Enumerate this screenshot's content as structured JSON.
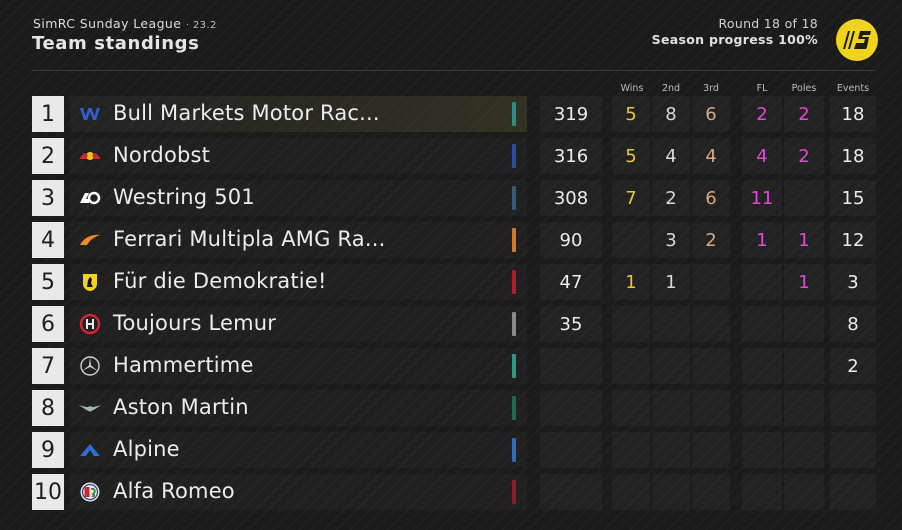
{
  "header": {
    "league": "SimRC Sunday League",
    "edition": "· 23.2",
    "title": "Team standings",
    "round": "Round 18 of 18",
    "progress": "Season progress 100%"
  },
  "columns": {
    "wins": "Wins",
    "second": "2nd",
    "third": "3rd",
    "fl": "FL",
    "poles": "Poles",
    "events": "Events"
  },
  "colors": {
    "wins": "#e8c53a",
    "second": "#d8d8d8",
    "third": "#d9a982",
    "fl": "#e04ad6",
    "poles": "#e04ad6",
    "brand": "#f2d31c"
  },
  "teams": [
    {
      "pos": "1",
      "name": "Bull Markets Motor Rac...",
      "icon": "williams-w-icon",
      "bar": "#2c8f86",
      "points": "319",
      "wins": "5",
      "second": "8",
      "third": "6",
      "fl": "2",
      "poles": "2",
      "events": "18"
    },
    {
      "pos": "2",
      "name": "Nordobst",
      "icon": "redbull-icon",
      "bar": "#2b4fa0",
      "points": "316",
      "wins": "5",
      "second": "4",
      "third": "4",
      "fl": "4",
      "poles": "2",
      "events": "18"
    },
    {
      "pos": "3",
      "name": "Westring 501",
      "icon": "alphatauri-icon",
      "bar": "#365a78",
      "points": "308",
      "wins": "7",
      "second": "2",
      "third": "6",
      "fl": "11",
      "poles": "",
      "events": "15"
    },
    {
      "pos": "4",
      "name": "Ferrari Multipla AMG Ra...",
      "icon": "mclaren-icon",
      "bar": "#d6782a",
      "points": "90",
      "wins": "",
      "second": "3",
      "third": "2",
      "fl": "1",
      "poles": "1",
      "events": "12"
    },
    {
      "pos": "5",
      "name": "Für die Demokratie!",
      "icon": "ferrari-icon",
      "bar": "#b01c2a",
      "points": "47",
      "wins": "1",
      "second": "1",
      "third": "",
      "fl": "",
      "poles": "1",
      "events": "3"
    },
    {
      "pos": "6",
      "name": "Toujours Lemur",
      "icon": "haas-icon",
      "bar": "#8a8a8a",
      "points": "35",
      "wins": "",
      "second": "",
      "third": "",
      "fl": "",
      "poles": "",
      "events": "8"
    },
    {
      "pos": "7",
      "name": "Hammertime",
      "icon": "mercedes-icon",
      "bar": "#2a9a86",
      "points": "",
      "wins": "",
      "second": "",
      "third": "",
      "fl": "",
      "poles": "",
      "events": "2"
    },
    {
      "pos": "8",
      "name": "Aston Martin",
      "icon": "aston-martin-icon",
      "bar": "#1f6b4e",
      "points": "",
      "wins": "",
      "second": "",
      "third": "",
      "fl": "",
      "poles": "",
      "events": ""
    },
    {
      "pos": "9",
      "name": "Alpine",
      "icon": "alpine-icon",
      "bar": "#2d6fb6",
      "points": "",
      "wins": "",
      "second": "",
      "third": "",
      "fl": "",
      "poles": "",
      "events": ""
    },
    {
      "pos": "10",
      "name": "Alfa Romeo",
      "icon": "alfa-romeo-icon",
      "bar": "#8a1c2a",
      "points": "",
      "wins": "",
      "second": "",
      "third": "",
      "fl": "",
      "poles": "",
      "events": ""
    }
  ]
}
